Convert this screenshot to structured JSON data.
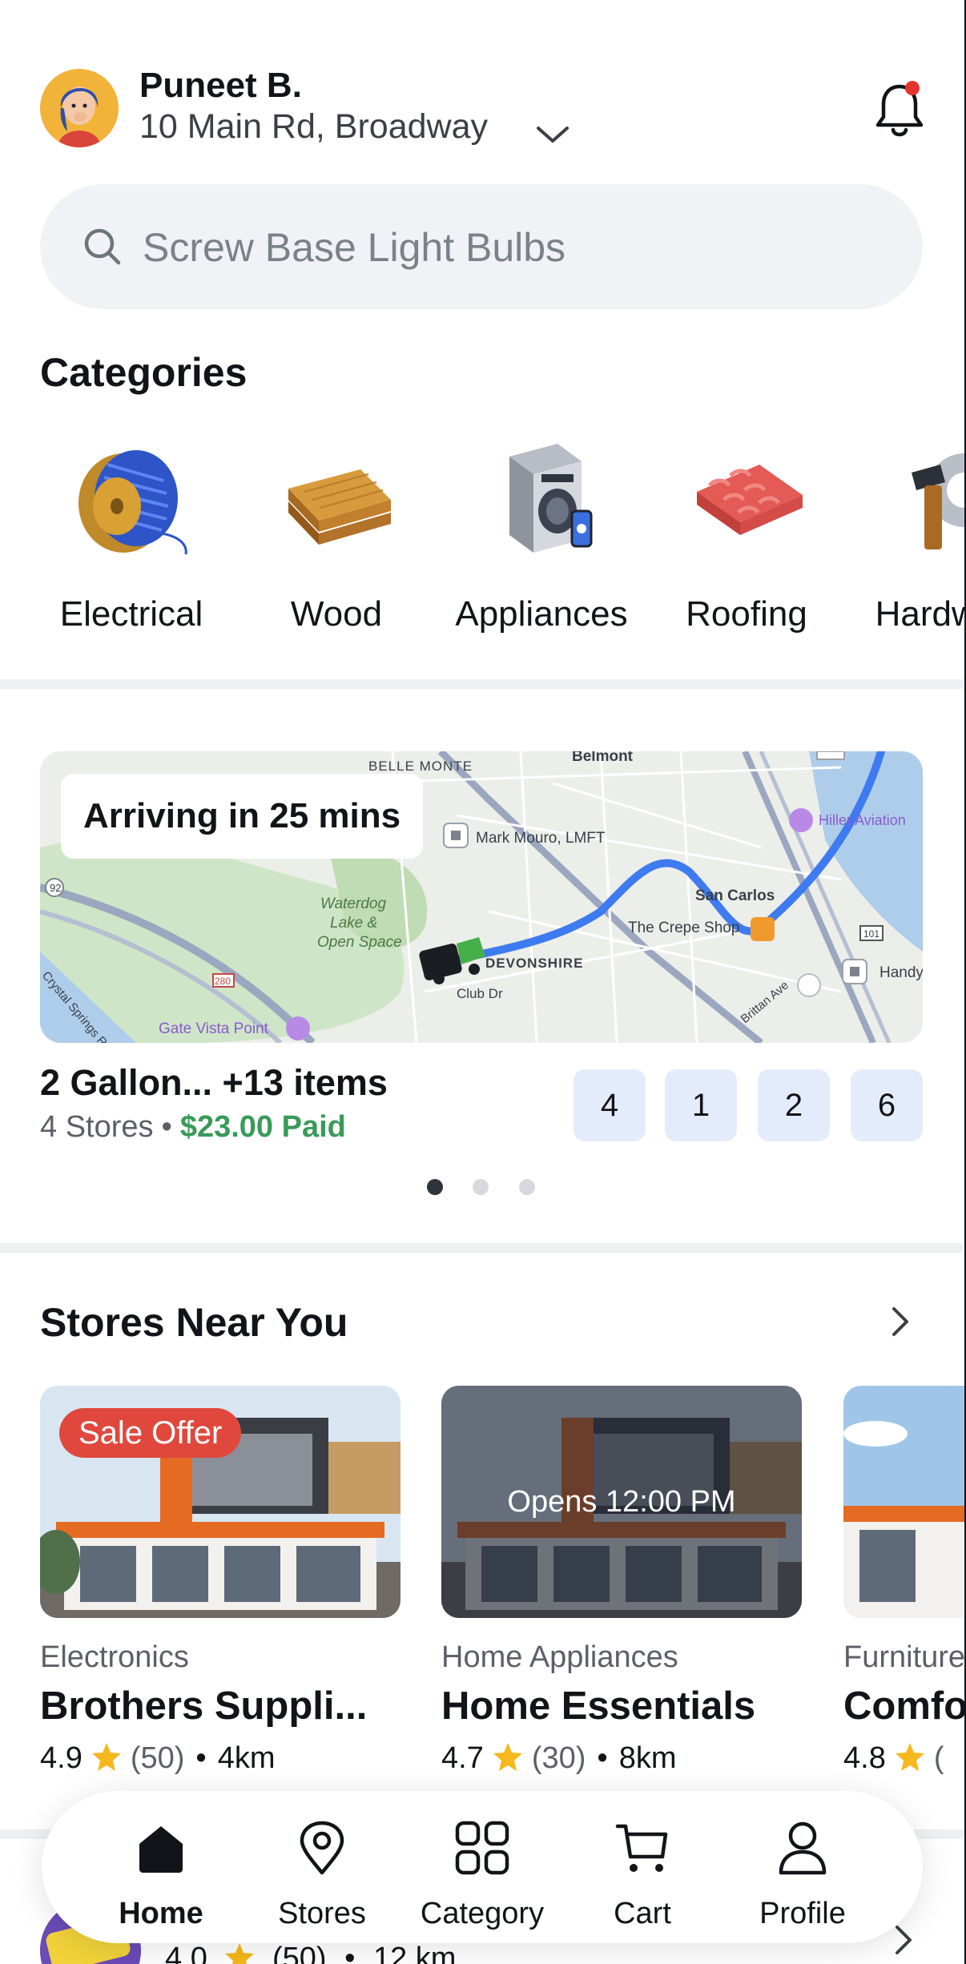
{
  "header": {
    "user_name": "Puneet B.",
    "address": "10 Main Rd, Broadway"
  },
  "search": {
    "placeholder": "Screw Base Light Bulbs"
  },
  "categories": {
    "title": "Categories",
    "items": [
      {
        "label": "Electrical",
        "icon": "cable-reel-icon"
      },
      {
        "label": "Wood",
        "icon": "wood-planks-icon"
      },
      {
        "label": "Appliances",
        "icon": "washing-machine-icon"
      },
      {
        "label": "Roofing",
        "icon": "roof-tiles-icon"
      },
      {
        "label": "Hardware",
        "icon": "hammer-gear-icon"
      }
    ]
  },
  "order": {
    "arriving": "Arriving in 25 mins",
    "map_labels": {
      "belle_monte": "BELLE MONTE",
      "belmont": "Belmont",
      "mark_mouro": "Mark Mouro, LMFT",
      "hiller": "Hiller Aviation",
      "waterdog": "Waterdog\nLake &\nOpen Space",
      "san_carlos": "San Carlos",
      "crepe": "The Crepe Shop",
      "devonshire": "DEVONSHIRE",
      "club_dr": "Club Dr",
      "gate_vista": "Gate Vista Point",
      "handy": "Handy",
      "r92": "92",
      "r280": "280",
      "r101": "101",
      "brittan": "Brittan Ave",
      "crystal": "Crystal Springs Rd"
    },
    "title": "2 Gallon... +13 items",
    "stores_text": "4 Stores",
    "paid_text": "$23.00 Paid",
    "store_counts": [
      "4",
      "1",
      "2",
      "6"
    ],
    "pager": {
      "count": 3,
      "active_index": 0
    }
  },
  "stores": {
    "title": "Stores Near You",
    "cards": [
      {
        "badge": "Sale Offer",
        "overlay": "",
        "category": "Electronics",
        "name": "Brothers Suppli...",
        "rating": "4.9",
        "reviews": "(50)",
        "distance": "4km"
      },
      {
        "badge": "",
        "overlay": "Opens 12:00 PM",
        "category": "Home Appliances",
        "name": "Home Essentials",
        "rating": "4.7",
        "reviews": "(30)",
        "distance": "8km"
      },
      {
        "badge": "",
        "overlay": "",
        "category": "Furniture",
        "name": "Comfort",
        "rating": "4.8",
        "reviews": "(",
        "distance": ""
      }
    ],
    "peek_row": {
      "rating": "4.0",
      "reviews": "(50)",
      "distance": "12 km"
    }
  },
  "nav": {
    "items": [
      {
        "label": "Home",
        "active": true
      },
      {
        "label": "Stores",
        "active": false
      },
      {
        "label": "Category",
        "active": false
      },
      {
        "label": "Cart",
        "active": false
      },
      {
        "label": "Profile",
        "active": false
      }
    ]
  },
  "colors": {
    "accent_green": "#3a9a5a",
    "route_blue": "#3f7bf0",
    "sale_red": "#e0483d",
    "notification_red": "#e5322d",
    "store_box_bg": "#e4ecfb"
  }
}
